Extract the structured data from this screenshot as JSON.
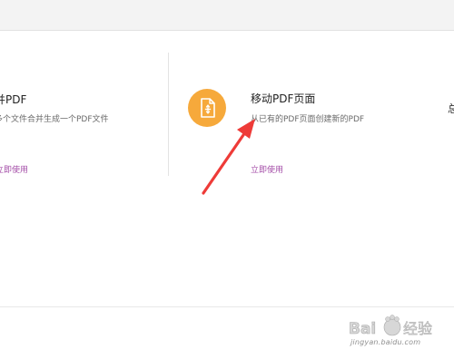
{
  "cards": [
    {
      "title": "并PDF",
      "desc": "多个文件合并生成一个PDF文件",
      "link": "立即使用"
    },
    {
      "title": "移动PDF页面",
      "desc": "从已有的PDF页面创建新的PDF",
      "link": "立即使用",
      "icon": "pdf-move-icon",
      "icon_color": "#f6a93b"
    }
  ],
  "partial_right_char": "总",
  "annotation": {
    "arrow_color": "#ee3b38"
  },
  "watermark": {
    "brand": "Bai度经验",
    "site": "jingyan.baidu.com"
  }
}
